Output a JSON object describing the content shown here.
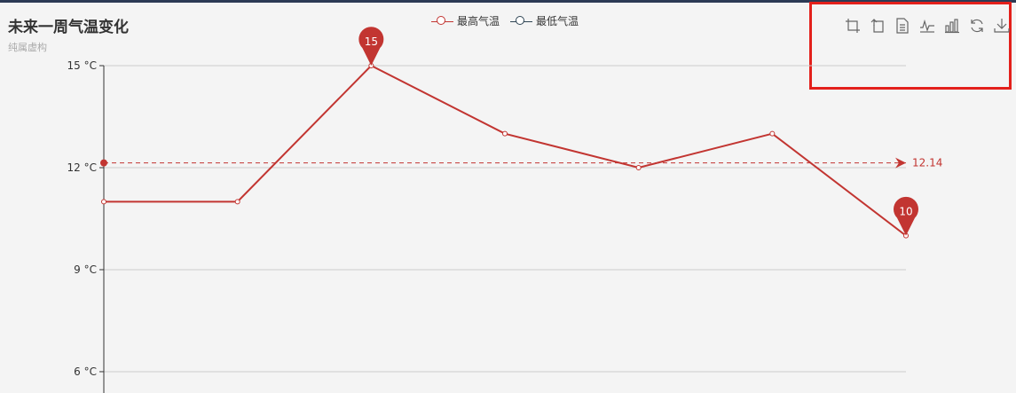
{
  "title": "未来一周气温变化",
  "subtitle": "纯属虚构",
  "legend": [
    {
      "name": "最高气温",
      "color": "#c23531"
    },
    {
      "name": "最低气温",
      "color": "#2f4554"
    }
  ],
  "toolbox": [
    {
      "icon": "zoom-icon"
    },
    {
      "icon": "zoom-reset-icon"
    },
    {
      "icon": "data-view-icon"
    },
    {
      "icon": "line-chart-icon"
    },
    {
      "icon": "bar-chart-icon"
    },
    {
      "icon": "restore-icon"
    },
    {
      "icon": "save-image-icon"
    }
  ],
  "chart_data": {
    "type": "line",
    "series": [
      {
        "name": "最高气温",
        "color": "#c23531",
        "values": [
          11,
          11,
          15,
          13,
          12,
          13,
          10
        ],
        "markPoints": [
          {
            "index": 2,
            "value": 15,
            "label": "15"
          },
          {
            "index": 6,
            "value": 10,
            "label": "10"
          }
        ],
        "markLine": {
          "value": 12.14,
          "label": "12.14"
        }
      }
    ],
    "y_ticks": [
      {
        "value": 15,
        "label": "15 °C"
      },
      {
        "value": 12,
        "label": "12 °C"
      },
      {
        "value": 9,
        "label": "9 °C"
      },
      {
        "value": 6,
        "label": "6 °C"
      }
    ],
    "grid": true
  }
}
